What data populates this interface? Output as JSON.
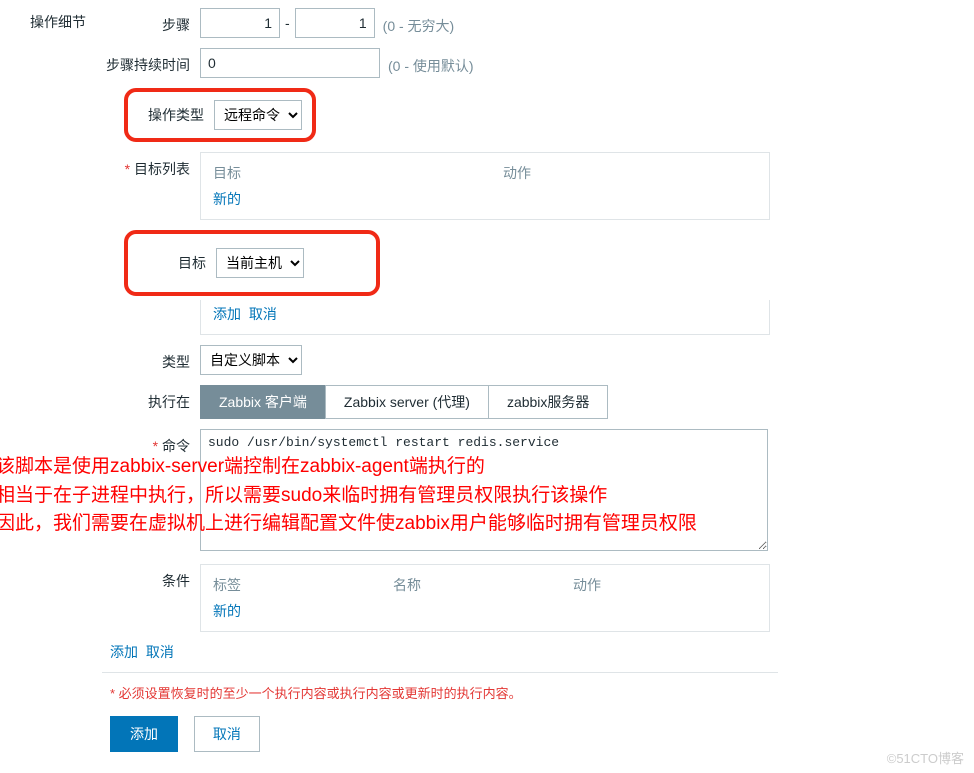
{
  "section_label": "操作细节",
  "steps": {
    "label": "步骤",
    "from": "1",
    "to": "1",
    "hint": "(0 - 无穷大)"
  },
  "step_duration": {
    "label": "步骤持续时间",
    "value": "0",
    "hint": "(0 - 使用默认)"
  },
  "operation_type": {
    "label": "操作类型",
    "value": "远程命令"
  },
  "target_list": {
    "label": "目标列表",
    "col_target": "目标",
    "col_action": "动作",
    "new_link": "新的"
  },
  "target": {
    "label": "目标",
    "value": "当前主机",
    "add_link": "添加",
    "cancel_link": "取消"
  },
  "type": {
    "label": "类型",
    "value": "自定义脚本"
  },
  "execute_on": {
    "label": "执行在",
    "options": [
      "Zabbix 客户端",
      "Zabbix server (代理)",
      "zabbix服务器"
    ],
    "active_index": 0
  },
  "command": {
    "label": "命令",
    "value": "sudo /usr/bin/systemctl restart redis.service"
  },
  "overlay": {
    "line1": "该脚本是使用zabbix-server端控制在zabbix-agent端执行的",
    "line2": "相当于在子进程中执行，所以需要sudo来临时拥有管理员权限执行该操作",
    "line3": "因此，我们需要在虚拟机上进行编辑配置文件使zabbix用户能够临时拥有管理员权限"
  },
  "conditions": {
    "label": "条件",
    "col_tag": "标签",
    "col_name": "名称",
    "col_action": "动作",
    "new_link": "新的"
  },
  "bottom_links": {
    "add": "添加",
    "cancel": "取消"
  },
  "footer_note": "* 必须设置恢复时的至少一个执行内容或执行内容或更新时的执行内容。",
  "buttons": {
    "add": "添加",
    "cancel": "取消"
  },
  "watermark": "©51CTO博客"
}
